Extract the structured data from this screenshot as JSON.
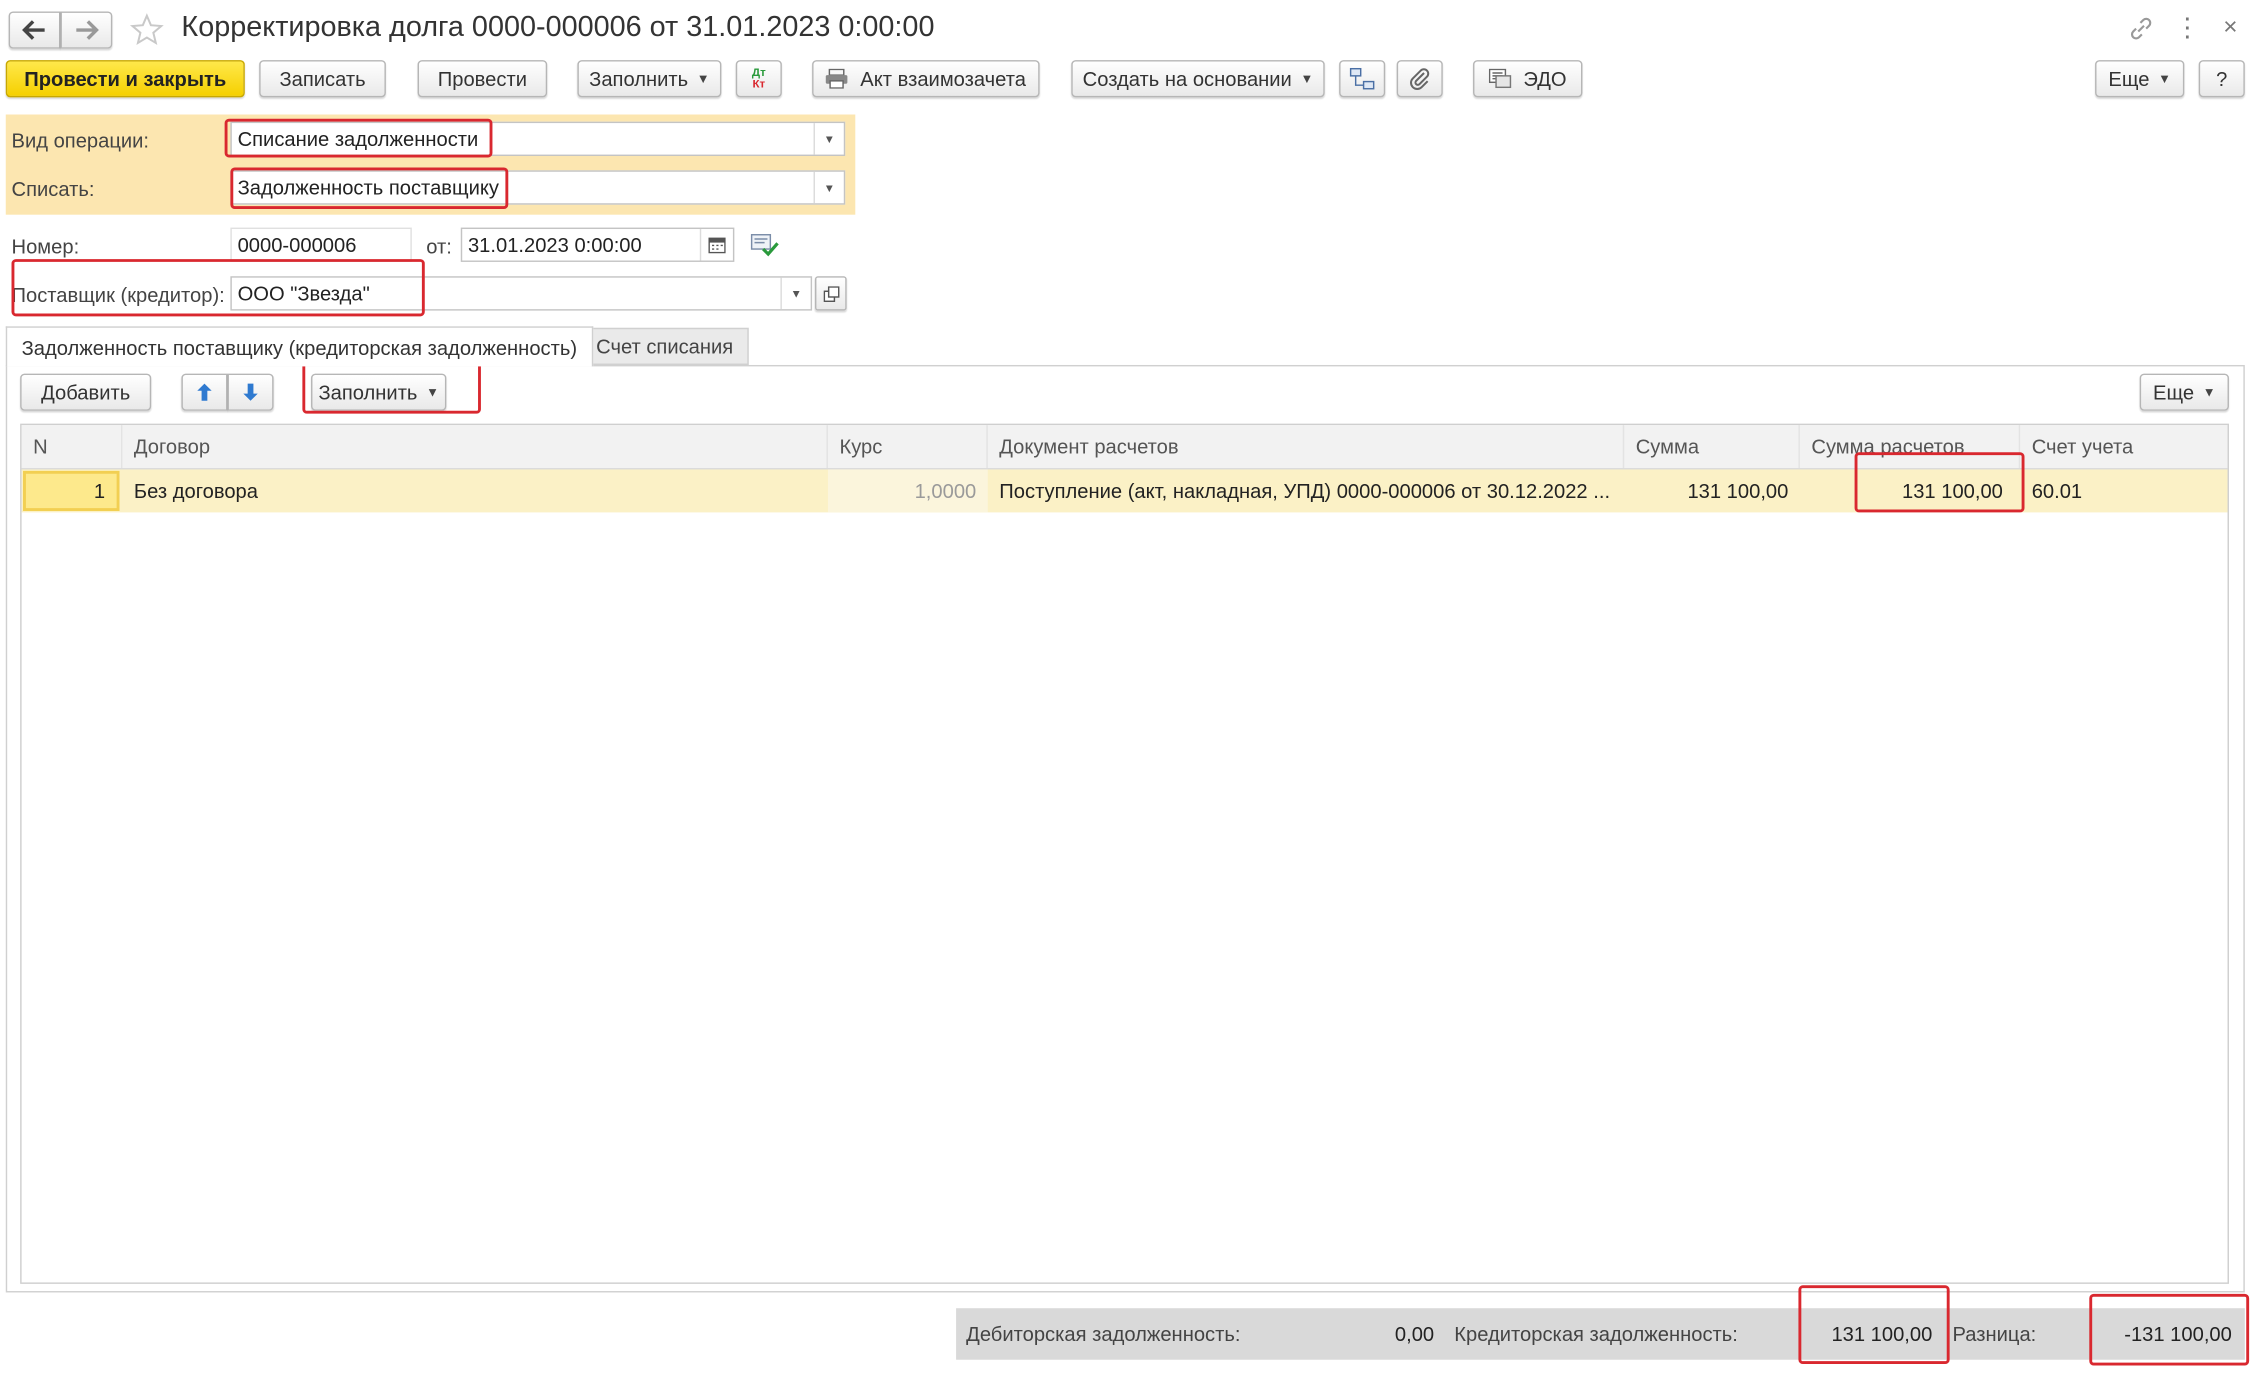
{
  "window": {
    "title": "Корректировка долга 0000-000006 от 31.01.2023 0:00:00"
  },
  "toolbar": {
    "post_close": "Провести и закрыть",
    "save": "Записать",
    "post": "Провести",
    "fill": "Заполнить",
    "dt_kt": "Дт Кт",
    "act": "Акт взаимозачета",
    "create_based": "Создать на основании",
    "edo": "ЭДО",
    "more": "Еще",
    "help": "?"
  },
  "form": {
    "operation_label": "Вид операции:",
    "operation_value": "Списание задолженности",
    "writeoff_label": "Списать:",
    "writeoff_value": "Задолженность поставщику",
    "number_label": "Номер:",
    "number_value": "0000-000006",
    "date_label": "от:",
    "date_value": "31.01.2023  0:00:00",
    "supplier_label": "Поставщик (кредитор):",
    "supplier_value": "ООО \"Звезда\""
  },
  "tabs": [
    {
      "label": "Задолженность поставщику (кредиторская задолженность)",
      "active": true
    },
    {
      "label": "Счет списания",
      "active": false
    }
  ],
  "table_toolbar": {
    "add": "Добавить",
    "fill": "Заполнить",
    "more": "Еще"
  },
  "table": {
    "columns": [
      "N",
      "Договор",
      "Курс",
      "Документ расчетов",
      "Сумма",
      "Сумма расчетов",
      "Счет учета"
    ],
    "rows": [
      {
        "n": "1",
        "contract": "Без договора",
        "rate": "1,0000",
        "document": "Поступление (акт, накладная, УПД) 0000-000006 от 30.12.2022 ...",
        "sum": "131 100,00",
        "settlement_sum": "131 100,00",
        "account": "60.01"
      }
    ]
  },
  "footer": {
    "debit_label": "Дебиторская задолженность:",
    "debit_value": "0,00",
    "credit_label": "Кредиторская задолженность:",
    "credit_value": "131 100,00",
    "diff_label": "Разница:",
    "diff_value": "-131 100,00"
  },
  "colors": {
    "primary_button": "#f5d000",
    "highlight_panel": "#fce6b0",
    "selected_row": "#fbf1c6",
    "annotation_red": "#d9282f",
    "footer_bg": "#d9d9d9"
  }
}
